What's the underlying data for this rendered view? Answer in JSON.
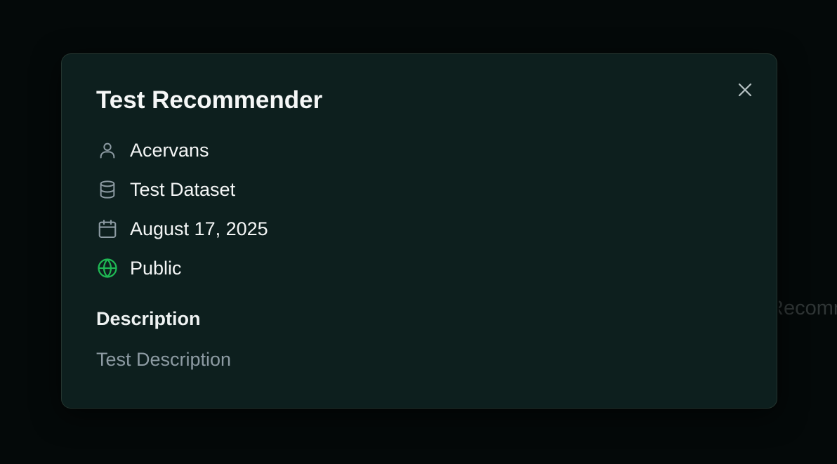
{
  "background": {
    "partial_text": "Recommender"
  },
  "modal": {
    "title": "Test Recommender",
    "close_icon": "close-icon",
    "meta": {
      "owner": {
        "icon": "user-icon",
        "value": "Acervans"
      },
      "dataset": {
        "icon": "database-icon",
        "value": "Test Dataset"
      },
      "date": {
        "icon": "calendar-icon",
        "value": "August 17, 2025"
      },
      "visibility": {
        "icon": "globe-icon",
        "value": "Public",
        "color": "#1fb854"
      }
    },
    "description": {
      "heading": "Description",
      "text": "Test Description"
    }
  },
  "colors": {
    "page_background": "#040909",
    "modal_background": "#0d1f1e",
    "modal_border": "#24352f",
    "icon_muted": "#8d9ba3",
    "accent_green": "#1fb854"
  }
}
